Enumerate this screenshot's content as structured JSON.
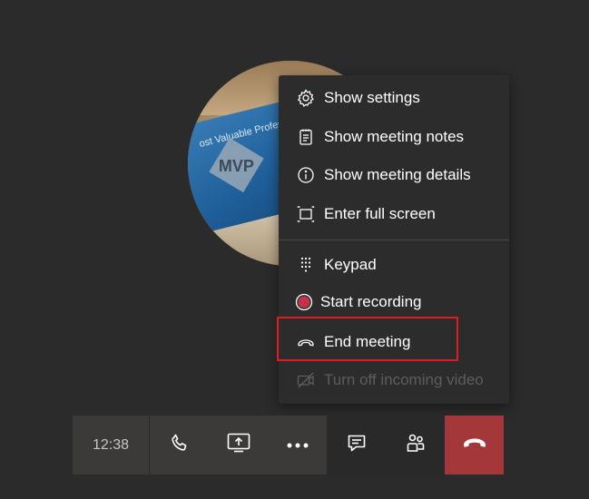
{
  "menu": {
    "items": [
      {
        "label": "Show settings",
        "icon": "gear-icon"
      },
      {
        "label": "Show meeting notes",
        "icon": "notes-icon"
      },
      {
        "label": "Show meeting details",
        "icon": "info-icon"
      },
      {
        "label": "Enter full screen",
        "icon": "fullscreen-icon"
      },
      {
        "label": "Keypad",
        "icon": "keypad-icon"
      },
      {
        "label": "Start recording",
        "icon": "record-icon"
      },
      {
        "label": "End meeting",
        "icon": "end-call-icon"
      },
      {
        "label": "Turn off incoming video",
        "icon": "video-off-icon"
      }
    ]
  },
  "avatar": {
    "text_top": "ost Valuable Professional",
    "text_logo": "MVP"
  },
  "callbar": {
    "time": "12:38"
  },
  "colors": {
    "background": "#2b2b2b",
    "menu_bg": "#2d2c2c",
    "record_red": "#c4314b",
    "hangup_red": "#a4373a",
    "highlight_red": "#e01b24"
  }
}
